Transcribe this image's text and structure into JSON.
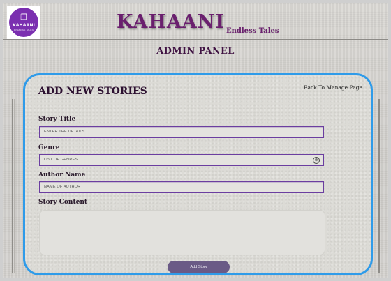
{
  "logo": {
    "glyph": "❐",
    "name": "KAHAANI",
    "tagline": "ENDLESS TALES"
  },
  "header": {
    "brand": "KAHAANI",
    "tagline": "Endless Tales",
    "section_title": "ADMIN PANEL"
  },
  "form": {
    "title": "ADD NEW STORIES",
    "back_link": "Back  To Manage Page",
    "fields": {
      "title": {
        "label": "Story Title",
        "placeholder": "ENTER THE DETAILS"
      },
      "genre": {
        "label": "Genre",
        "placeholder": "LIST OF GENRES",
        "clear_icon": "⊗"
      },
      "author": {
        "label": "Author Name",
        "placeholder": "NAME OF AUTHOR"
      },
      "content": {
        "label": "Story Content",
        "value": ""
      }
    },
    "submit_label": "Add Story"
  },
  "colors": {
    "brand_purple": "#6a1f6e",
    "logo_purple": "#7b2fb0",
    "card_border": "#2f9be9",
    "field_border": "#6b3ea0",
    "button": "#6a5a86"
  }
}
